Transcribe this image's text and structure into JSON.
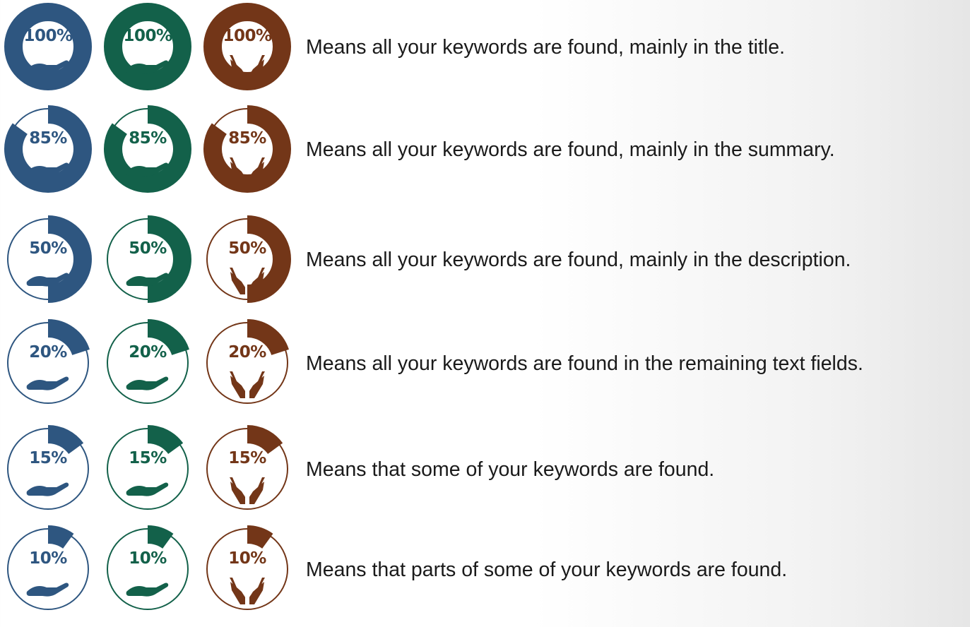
{
  "colors": {
    "blue": "#2e5680",
    "green": "#13614a",
    "brown": "#733618"
  },
  "icons": {
    "blue": "open-hand-icon",
    "green": "open-hand-icon",
    "brown": "cupped-hands-icon"
  },
  "rows": [
    {
      "percent": 100,
      "label": "100%",
      "description": "Means all your keywords are found, mainly in the title."
    },
    {
      "percent": 85,
      "label": "85%",
      "description": "Means all your keywords are found, mainly in the summary."
    },
    {
      "percent": 50,
      "label": "50%",
      "description": "Means all your keywords are found, mainly in the description."
    },
    {
      "percent": 20,
      "label": "20%",
      "description": "Means all your keywords are found in the remaining text fields."
    },
    {
      "percent": 15,
      "label": "15%",
      "description": "Means that some of your keywords are found."
    },
    {
      "percent": 10,
      "label": "10%",
      "description": "Means that parts of some of your keywords are found."
    }
  ]
}
